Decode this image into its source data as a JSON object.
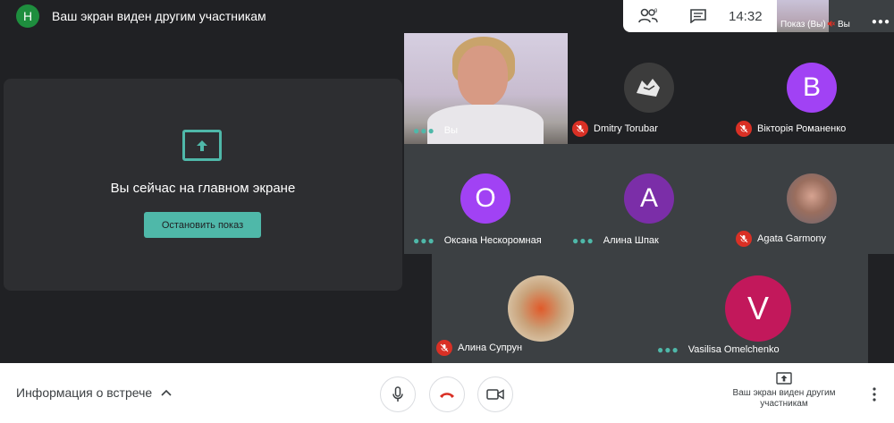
{
  "header": {
    "avatar_letter": "Н",
    "title": "Ваш экран виден другим участникам",
    "clock": "14:32"
  },
  "self_preview": {
    "label": "Показ (Вы)",
    "name": "Вы"
  },
  "presenting": {
    "message": "Вы сейчас на главном экране",
    "stop_label": "Остановить показ"
  },
  "participants": [
    {
      "name": "Вы",
      "initial": "",
      "color": "",
      "muted": false
    },
    {
      "name": "Dmitry Torubar",
      "initial": "",
      "color": "#3c3c3c",
      "muted": true
    },
    {
      "name": "Вікторія Романенко",
      "initial": "В",
      "color": "#a142f4",
      "muted": true
    },
    {
      "name": "Оксана Нескоромная",
      "initial": "О",
      "color": "#a142f4",
      "muted": false
    },
    {
      "name": "Алина Шпак",
      "initial": "А",
      "color": "#7b2ea8",
      "muted": false
    },
    {
      "name": "Agata Garmony",
      "initial": "",
      "color": "#7a6a66",
      "muted": true
    },
    {
      "name": "Алина Супрун",
      "initial": "",
      "color": "#c9a27a",
      "muted": true
    },
    {
      "name": "Vasilisa Omelchenko",
      "initial": "V",
      "color": "#c2185b",
      "muted": false
    }
  ],
  "bottom": {
    "info_label": "Информация о встрече",
    "present_status": "Ваш экран виден другим участникам"
  },
  "colors": {
    "accent": "#4fb8a9",
    "danger": "#d93025",
    "background": "#202124",
    "tile": "#3c4043"
  }
}
